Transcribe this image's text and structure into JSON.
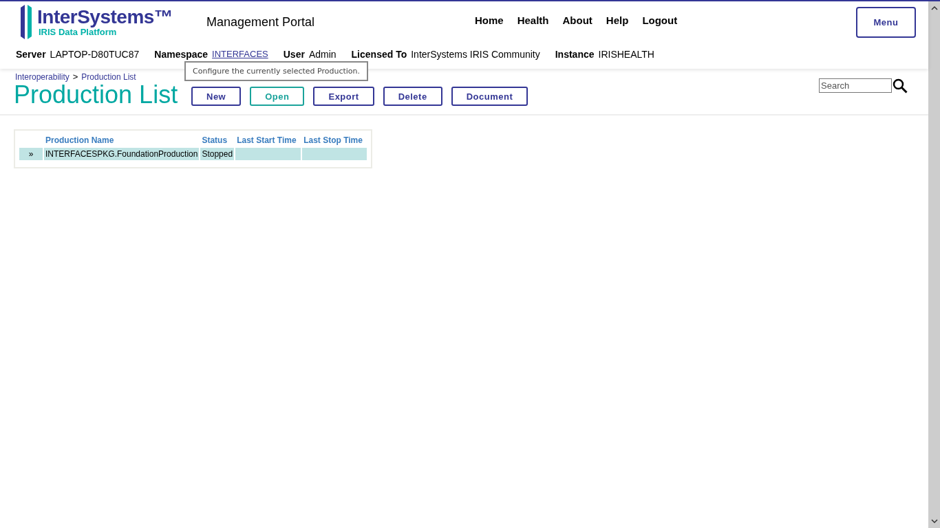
{
  "logo": {
    "brand": "InterSystems™",
    "product": "IRIS Data Platform"
  },
  "app_title": "Management Portal",
  "nav": [
    "Home",
    "Health",
    "About",
    "Help",
    "Logout"
  ],
  "menu_button": "Menu",
  "info": [
    {
      "label": "Server",
      "value": "LAPTOP-D80TUC87",
      "kind": "text"
    },
    {
      "label": "Namespace",
      "value": "INTERFACES",
      "kind": "link"
    },
    {
      "label": "User",
      "value": "Admin",
      "kind": "text"
    },
    {
      "label": "Licensed To",
      "value": "InterSystems IRIS Community",
      "kind": "text"
    },
    {
      "label": "Instance",
      "value": "IRISHEALTH",
      "kind": "text"
    }
  ],
  "tooltip": "Configure the currently selected Production.",
  "breadcrumb": [
    "Interoperability",
    "Production List"
  ],
  "breadcrumb_separator": ">",
  "page_title": "Production List",
  "buttons": [
    {
      "label": "New",
      "highlighted": false
    },
    {
      "label": "Open",
      "highlighted": true
    },
    {
      "label": "Export",
      "highlighted": false
    },
    {
      "label": "Delete",
      "highlighted": false
    },
    {
      "label": "Document",
      "highlighted": false
    }
  ],
  "search": {
    "placeholder": "Search"
  },
  "table": {
    "columns": [
      "Production Name",
      "Status",
      "Last Start Time",
      "Last Stop Time"
    ],
    "rows": [
      {
        "marker": "»",
        "cells": [
          "INTERFACESPKG.FoundationProduction",
          "Stopped",
          "",
          ""
        ],
        "selected": true
      }
    ]
  }
}
